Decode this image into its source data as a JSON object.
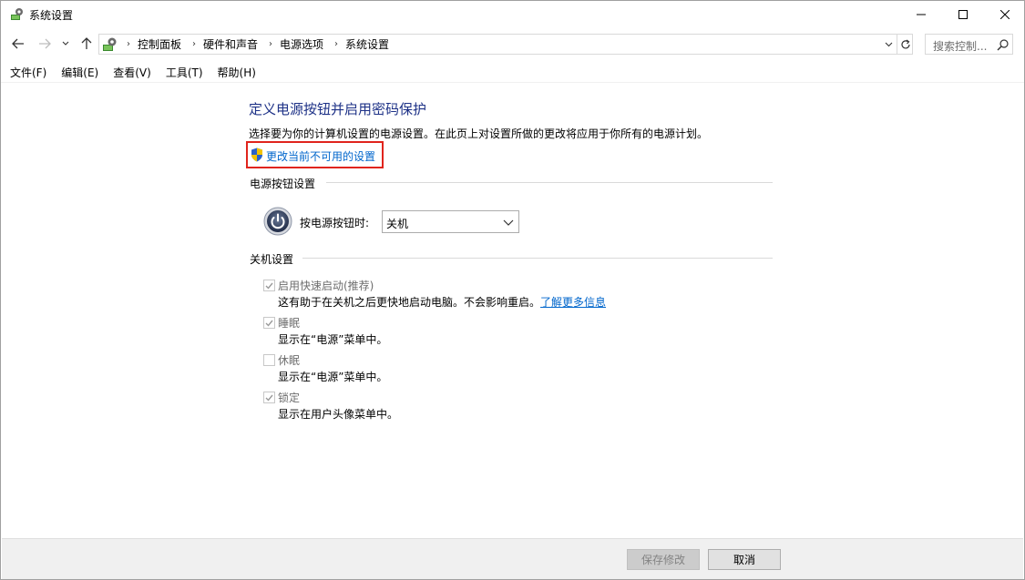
{
  "window": {
    "title": "系统设置"
  },
  "address": {
    "breadcrumbs": [
      "控制面板",
      "硬件和声音",
      "电源选项",
      "系统设置"
    ],
    "search_placeholder": "搜索控制..."
  },
  "menu": [
    "文件(F)",
    "编辑(E)",
    "查看(V)",
    "工具(T)",
    "帮助(H)"
  ],
  "main": {
    "title": "定义电源按钮并启用密码保护",
    "description": "选择要为你的计算机设置的电源设置。在此页上对设置所做的更改将应用于你所有的电源计划。",
    "change_link": "更改当前不可用的设置",
    "power_section": {
      "heading": "电源按钮设置",
      "label": "按电源按钮时:",
      "selected": "关机"
    },
    "shutdown_section": {
      "heading": "关机设置",
      "items": [
        {
          "label": "启用快速启动(推荐)",
          "desc": "这有助于在关机之后更快地启动电脑。不会影响重启。",
          "link": "了解更多信息",
          "checked": true
        },
        {
          "label": "睡眠",
          "desc": "显示在“电源”菜单中。",
          "checked": true
        },
        {
          "label": "休眠",
          "desc": "显示在“电源”菜单中。",
          "checked": false
        },
        {
          "label": "锁定",
          "desc": "显示在用户头像菜单中。",
          "checked": true
        }
      ]
    }
  },
  "footer": {
    "save_label": "保存修改",
    "cancel_label": "取消"
  },
  "colors": {
    "title": "#1e3287",
    "link": "#0066cc",
    "highlight_box": "#e0241c"
  }
}
